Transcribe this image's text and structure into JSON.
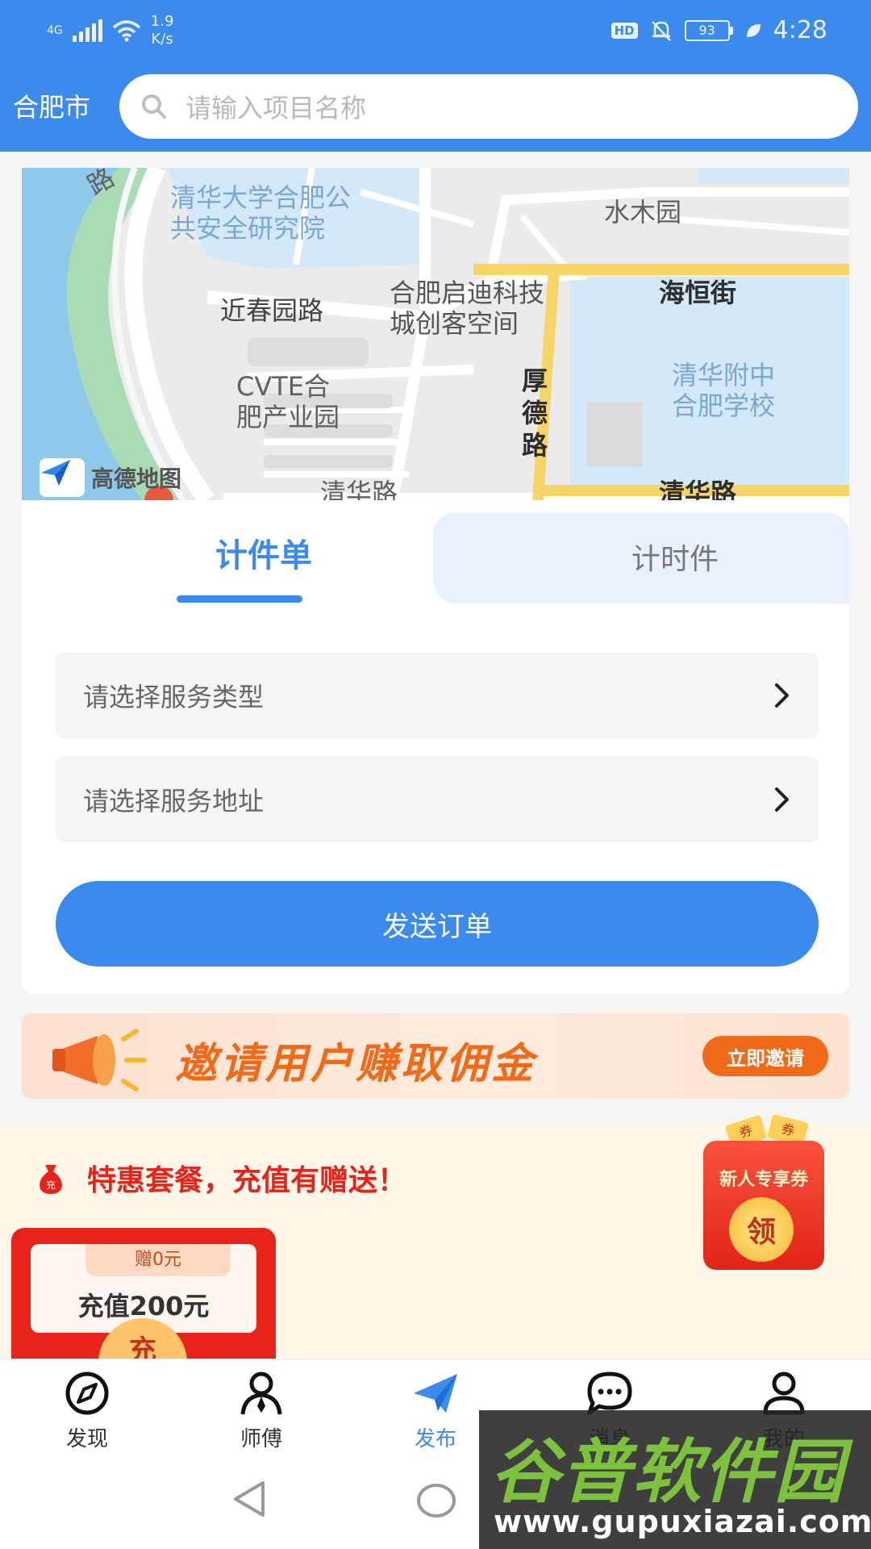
{
  "status_bar": {
    "network": "4G",
    "speed_value": "1.9",
    "speed_unit": "K/s",
    "hd": "HD",
    "battery": "93",
    "time": "4:28"
  },
  "header": {
    "city": "合肥市",
    "search_placeholder": "请输入项目名称"
  },
  "map": {
    "labels": {
      "road_top": "路",
      "tsinghua_institute": "清华大学合肥公\n共安全研究院",
      "shuimu": "水木园",
      "jinchun": "近春园路",
      "qidi": "合肥启迪科技\n城创客空间",
      "haiheng": "海恒街",
      "houde": "厚\n德\n路",
      "cvte": "CVTE合\n肥产业园",
      "school": "清华附中\n合肥学校",
      "qinghua_left": "清华路",
      "qinghua_right": "清华路"
    },
    "logo_text": "高德地图"
  },
  "order": {
    "tabs": [
      "计件单",
      "计时件"
    ],
    "active_tab": 0,
    "service_type": "请选择服务类型",
    "service_address": "请选择服务地址",
    "send_label": "发送订单"
  },
  "invite": {
    "text": "邀请用户赚取佣金",
    "button": "立即邀请"
  },
  "promo": {
    "bag_text": "充",
    "title": "特惠套餐，充值有赠送！",
    "package": {
      "gift": "赠0元",
      "amount": "充值200元",
      "coin": "充"
    },
    "coupon": {
      "ticket": "券",
      "text": "新人专享券",
      "coin": "领"
    }
  },
  "bottom_nav": {
    "items": [
      "发现",
      "师傅",
      "发布",
      "消息",
      "我的"
    ],
    "active": 2
  },
  "watermark": {
    "title": "谷普软件园",
    "url": "www.gupuxiazai.com"
  },
  "colors": {
    "brand_blue": "#3b8bee",
    "promo_red": "#e8231a",
    "invite_orange": "#f06a1a"
  }
}
